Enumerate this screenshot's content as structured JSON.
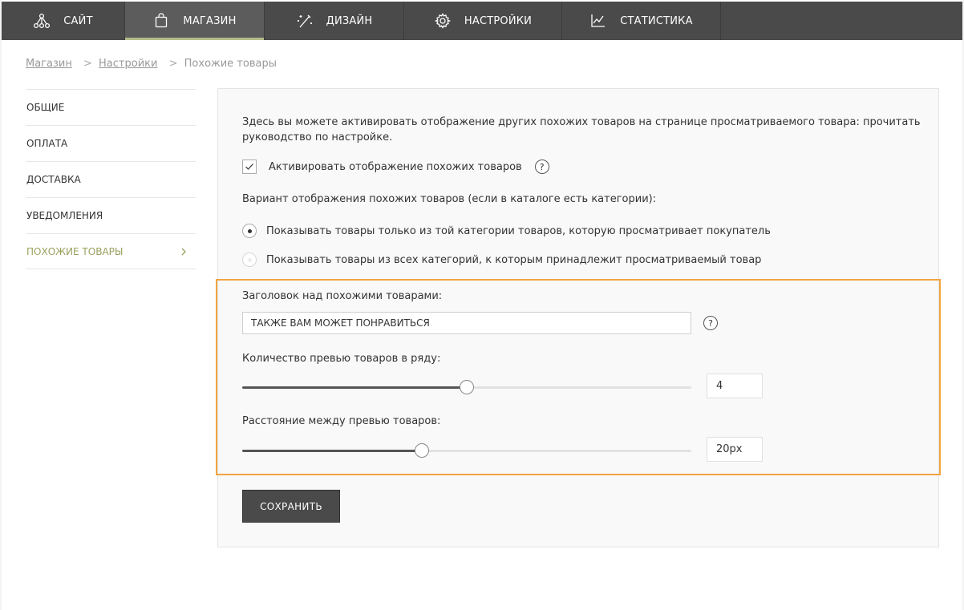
{
  "nav": {
    "items": [
      {
        "label": "САЙТ",
        "icon": "site-network-icon"
      },
      {
        "label": "МАГАЗИН",
        "icon": "shopping-bag-icon"
      },
      {
        "label": "ДИЗАЙН",
        "icon": "magic-wand-icon"
      },
      {
        "label": "НАСТРОЙКИ",
        "icon": "gear-icon"
      },
      {
        "label": "СТАТИСТИКА",
        "icon": "line-chart-icon"
      }
    ],
    "active_index": 1,
    "active_color": "#b5bd8b"
  },
  "breadcrumb": {
    "items": [
      "Магазин",
      "Настройки"
    ],
    "current": "Похожие товары",
    "separator": ">"
  },
  "sidebar": {
    "items": [
      {
        "label": "ОБЩИЕ"
      },
      {
        "label": "ОПЛАТА"
      },
      {
        "label": "ДОСТАВКА"
      },
      {
        "label": "УВЕДОМЛЕНИЯ"
      },
      {
        "label": "ПОХОЖИЕ ТОВАРЫ"
      }
    ],
    "active_index": 4,
    "active_color": "#9aa15f"
  },
  "main": {
    "intro": "Здесь вы можете активировать отображение других похожих товаров на странице просматриваемого товара: прочитать руководство по настройке.",
    "activate_checkbox": {
      "label": "Активировать отображение похожих товаров",
      "checked": true
    },
    "help_symbol": "?",
    "variant_label": "Вариант отображения похожих товаров (если в каталоге есть категории):",
    "radio_options": [
      {
        "label": "Показывать товары только из той категории товаров, которую просматривает покупатель",
        "selected": true
      },
      {
        "label": "Показывать товары из всех категорий, к которым принадлежит просматриваемый товар",
        "selected": false
      }
    ],
    "heading_field": {
      "label": "Заголовок над похожими товарами:",
      "value": "ТАКЖЕ ВАМ МОЖЕТ ПОНРАВИТЬСЯ"
    },
    "count_slider": {
      "label": "Количество превью товаров в ряду:",
      "value_text": "4",
      "fill_fraction": 0.5
    },
    "gap_slider": {
      "label": "Расстояние между превью товаров:",
      "value_text": "20px",
      "fill_fraction": 0.4
    },
    "highlight_color": "#f0a542",
    "save_label": "СОХРАНИТЬ"
  }
}
